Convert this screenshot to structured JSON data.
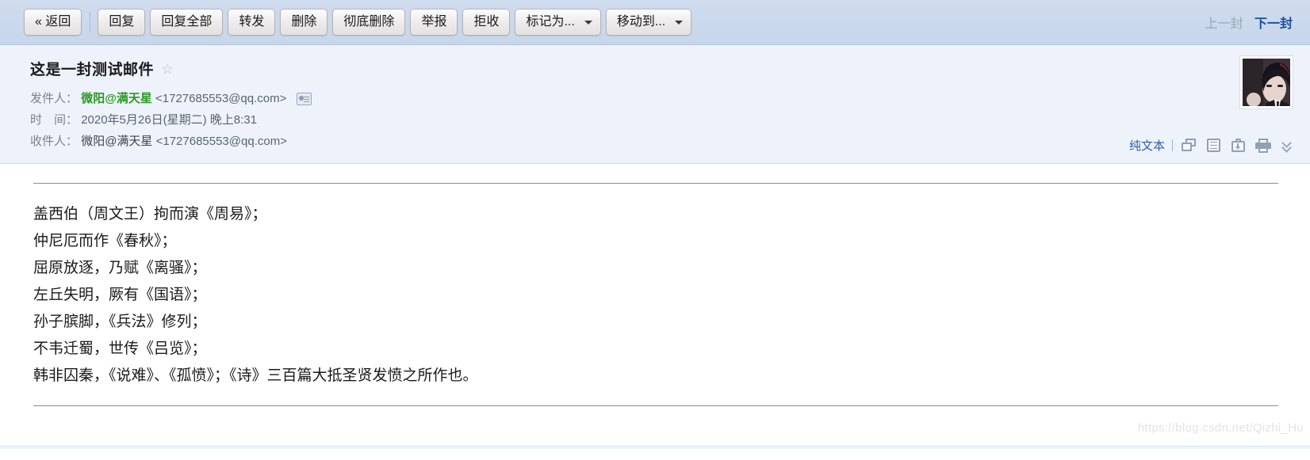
{
  "toolbar": {
    "buttons": [
      {
        "label": "« 返回",
        "name": "back-button",
        "caret": false
      },
      {
        "label": "回复",
        "name": "reply-button",
        "caret": false
      },
      {
        "label": "回复全部",
        "name": "reply-all-button",
        "caret": false
      },
      {
        "label": "转发",
        "name": "forward-button",
        "caret": false
      },
      {
        "label": "删除",
        "name": "delete-button",
        "caret": false
      },
      {
        "label": "彻底删除",
        "name": "permanent-delete-button",
        "caret": false
      },
      {
        "label": "举报",
        "name": "report-button",
        "caret": false
      },
      {
        "label": "拒收",
        "name": "reject-button",
        "caret": false
      },
      {
        "label": "标记为...",
        "name": "mark-as-dropdown",
        "caret": true
      },
      {
        "label": "移动到...",
        "name": "move-to-dropdown",
        "caret": true
      }
    ],
    "prev_label": "上一封",
    "next_label": "下一封"
  },
  "mail": {
    "subject": "这是一封测试邮件",
    "star_glyph": "☆",
    "from_label": "发件人：",
    "from_name": "微阳@满天星",
    "from_address": "<1727685553@qq.com>",
    "time_label": "时　间：",
    "time_value": "2020年5月26日(星期二) 晚上8:31",
    "to_label": "收件人：",
    "to_name": "微阳@满天星",
    "to_address": "<1727685553@qq.com>",
    "plain_text_link": "纯文本",
    "icons": [
      "new-window-icon",
      "note-icon",
      "save-icon",
      "print-icon",
      "expand-chevrons-icon"
    ],
    "body_lines": [
      "盖西伯（周文王）拘而演《周易》；",
      "仲尼厄而作《春秋》；",
      "屈原放逐，乃赋《离骚》；",
      "左丘失明，厥有《国语》；",
      "孙子膑脚，《兵法》修列；",
      "不韦迁蜀，世传《吕览》；",
      "韩非囚秦，《说难》、《孤愤》；《诗》三百篇大抵圣贤发愤之所作也。"
    ]
  },
  "watermark": "https://blog.csdn.net/Qizhi_Hu",
  "colors": {
    "toolbar_bg": "#cfdcee",
    "header_bg": "#eef2fb",
    "sender_green": "#2b9a22",
    "link_blue": "#2c5fa8",
    "next_blue": "#1a4f9c"
  }
}
